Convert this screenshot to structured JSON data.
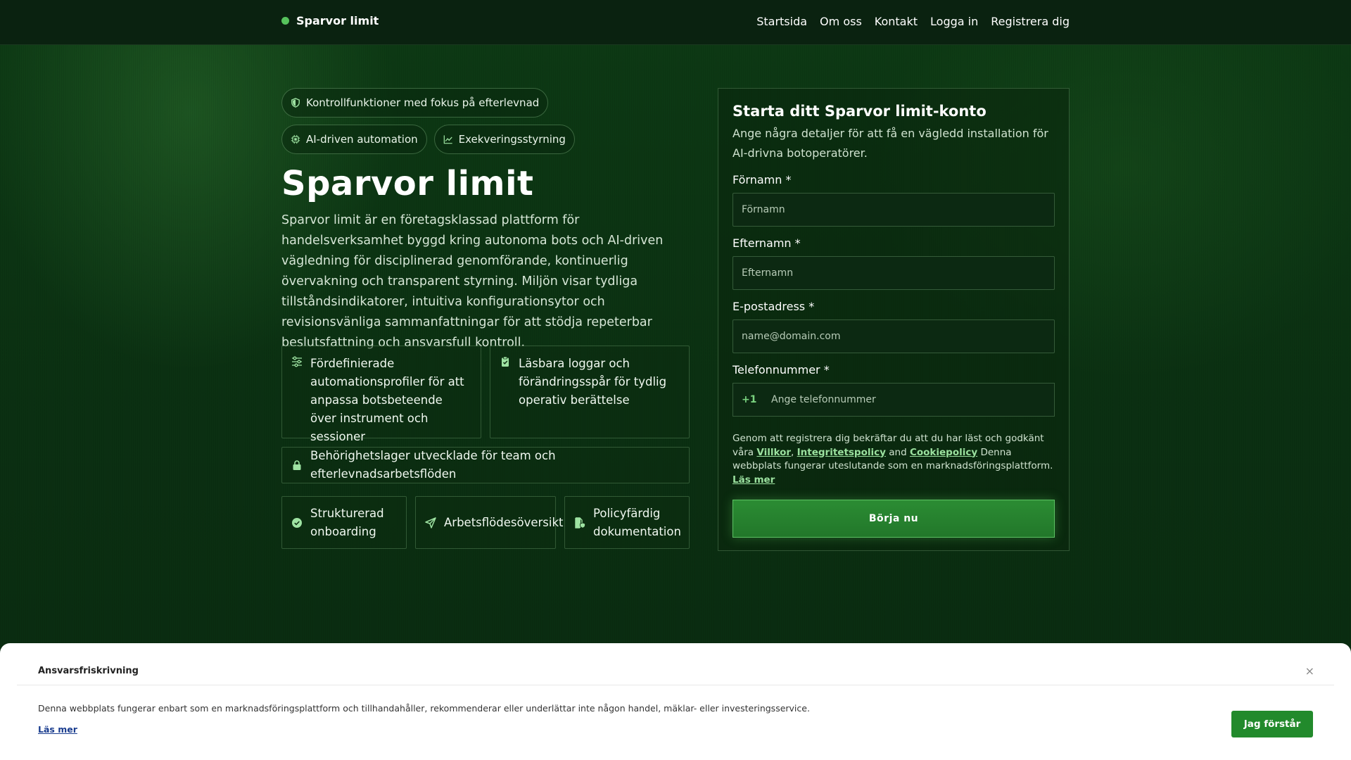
{
  "header": {
    "brand": "Sparvor limit",
    "nav": [
      "Startsida",
      "Om oss",
      "Kontakt",
      "Logga in",
      "Registrera dig"
    ]
  },
  "hero": {
    "chips": [
      {
        "label": "Kontrollfunktioner med fokus på efterlevnad",
        "icon": "shield-icon"
      },
      {
        "label": "AI-driven automation",
        "icon": "chip-icon"
      },
      {
        "label": "Exekveringsstyrning",
        "icon": "chart-line-icon"
      }
    ],
    "title": "Sparvor limit",
    "description": "Sparvor limit är en företagsklassad plattform för handelsverksamhet byggd kring autonoma bots och AI-driven vägledning för disciplinerad genomförande, kontinuerlig övervakning och transparent styrning. Miljön visar tydliga tillståndsindikatorer, intuitiva konfigurationsytor och revisionsvänliga sammanfattningar för att stödja repeterbar beslutsfattning och ansvarsfull kontroll.",
    "features": [
      {
        "text": "Fördefinierade automationsprofiler för att anpassa botsbeteende över instrument och sessioner",
        "icon": "sliders-icon"
      },
      {
        "text": "Läsbara loggar och förändringsspår för tydlig operativ berättelse",
        "icon": "clipboard-check-icon"
      },
      {
        "text": "Behörighetslager utvecklade för team och efterlevnadsarbetsflöden",
        "icon": "lock-icon"
      },
      {
        "text": "Strukturerad onboarding",
        "icon": "check-circle-icon"
      },
      {
        "text": "Arbetsflödesöversikt",
        "icon": "send-icon"
      },
      {
        "text": "Policyfärdig dokumentation",
        "icon": "file-shield-icon"
      }
    ]
  },
  "form": {
    "title": "Starta ditt Sparvor limit-konto",
    "subtitle": "Ange några detaljer för att få en vägledd installation för AI-drivna botoperatörer.",
    "first_name_label": "Förnamn *",
    "first_name_placeholder": "Förnamn",
    "last_name_label": "Efternamn *",
    "last_name_placeholder": "Efternamn",
    "email_label": "E-postadress *",
    "email_placeholder": "name@domain.com",
    "phone_label": "Telefonnummer *",
    "phone_prefix": "+1",
    "phone_placeholder": "Ange telefonnummer",
    "legal_prefix": "Genom att registrera dig bekräftar du att du har läst och godkänt våra",
    "terms_link": "Villkor",
    "sep1": ",",
    "privacy_link": "Integritetspolicy",
    "and": "and",
    "cookie_link": "Cookiepolicy",
    "legal_suffix": "Denna webbplats fungerar uteslutande som en marknadsföringsplattform.",
    "read_more": "Läs mer",
    "submit": "Börja nu"
  },
  "disclaimer": {
    "title": "Ansvarsfriskrivning",
    "close": "×",
    "text": "Denna webbplats fungerar enbart som en marknadsföringsplattform och tillhandahåller, rekommenderar eller underlättar inte någon handel, mäklar- eller investeringsservice.",
    "link": "Läs mer",
    "button": "Jag förstår"
  },
  "colors": {
    "accent": "#56c35c",
    "button": "#228a2c",
    "background": "#0b3012"
  }
}
